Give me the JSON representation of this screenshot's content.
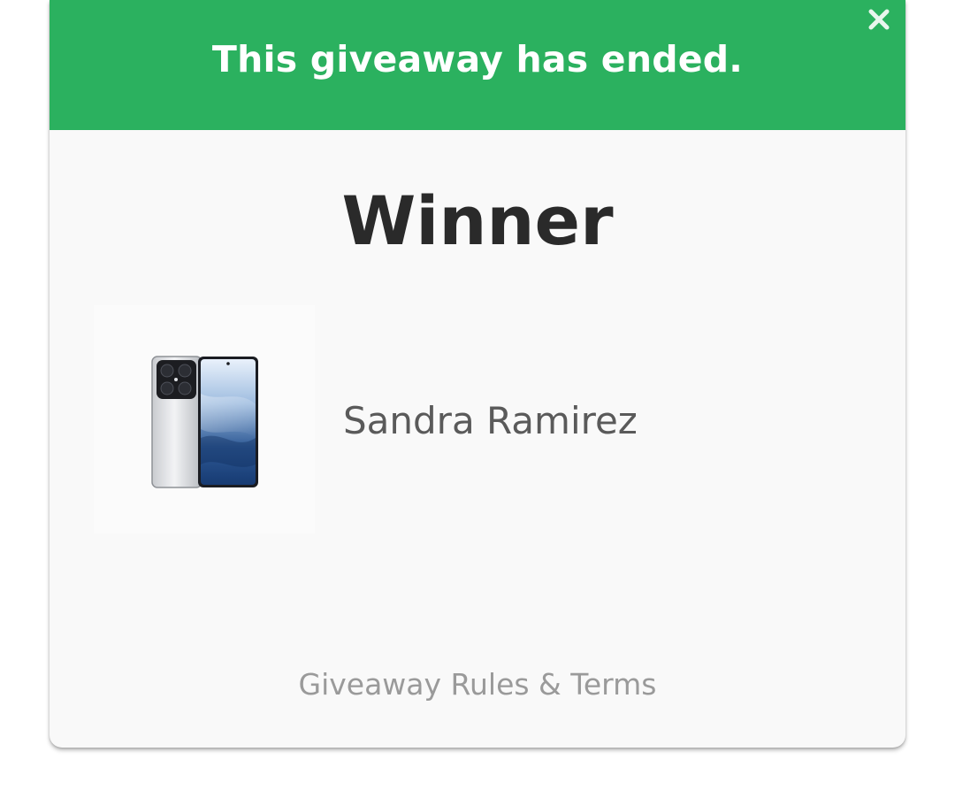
{
  "banner": {
    "message": "This giveaway has ended.",
    "color": "#2bb15f",
    "close_icon": "close-icon"
  },
  "result": {
    "title": "Winner",
    "winner_name": "Sandra Ramirez",
    "prize_image_icon": "smartphone-product-image"
  },
  "footer": {
    "rules_link": "Giveaway Rules & Terms"
  }
}
